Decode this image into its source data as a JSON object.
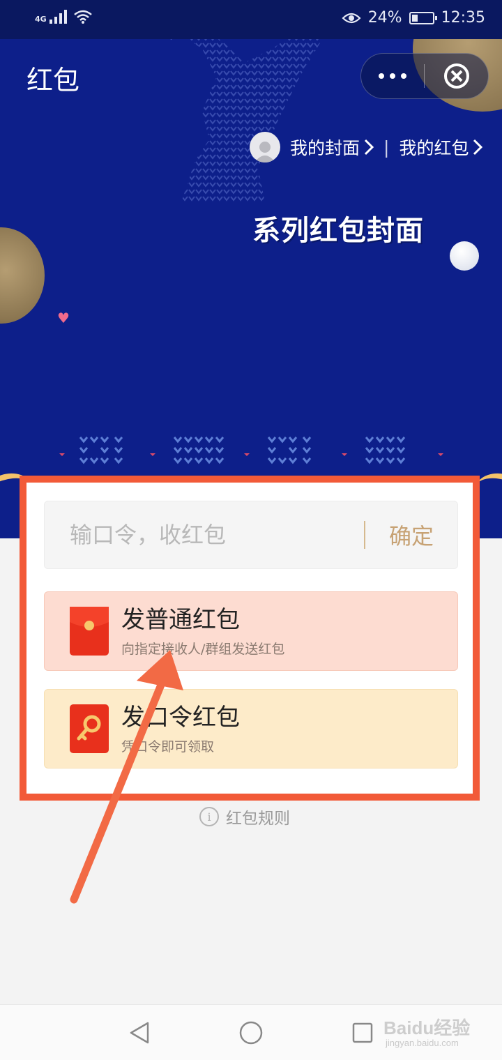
{
  "status_bar": {
    "network": "4G",
    "battery_percent": "24%",
    "time": "12:35"
  },
  "header": {
    "title": "红包"
  },
  "cover_links": {
    "my_cover": "我的封面",
    "my_red_packets": "我的红包",
    "divider": "|"
  },
  "banner": {
    "title": "系列红包封面"
  },
  "code_entry": {
    "placeholder": "输口令，收红包",
    "value": "",
    "confirm_label": "确定"
  },
  "options": [
    {
      "title": "发普通红包",
      "subtitle": "向指定接收人/群组发送红包",
      "icon": "red-envelope-icon"
    },
    {
      "title": "发口令红包",
      "subtitle": "凭口令即可领取",
      "icon": "key-icon"
    }
  ],
  "rules": {
    "label": "红包规则"
  },
  "watermark": {
    "brand": "Baidu经验",
    "url": "jingyan.baidu.com"
  },
  "colors": {
    "banner": "#0d1f8a",
    "highlight": "#f25a38",
    "confirm": "#c7a274",
    "normal_option_bg": "#fddcd1",
    "code_option_bg": "#fdebc9",
    "icon_red": "#e8301c"
  }
}
